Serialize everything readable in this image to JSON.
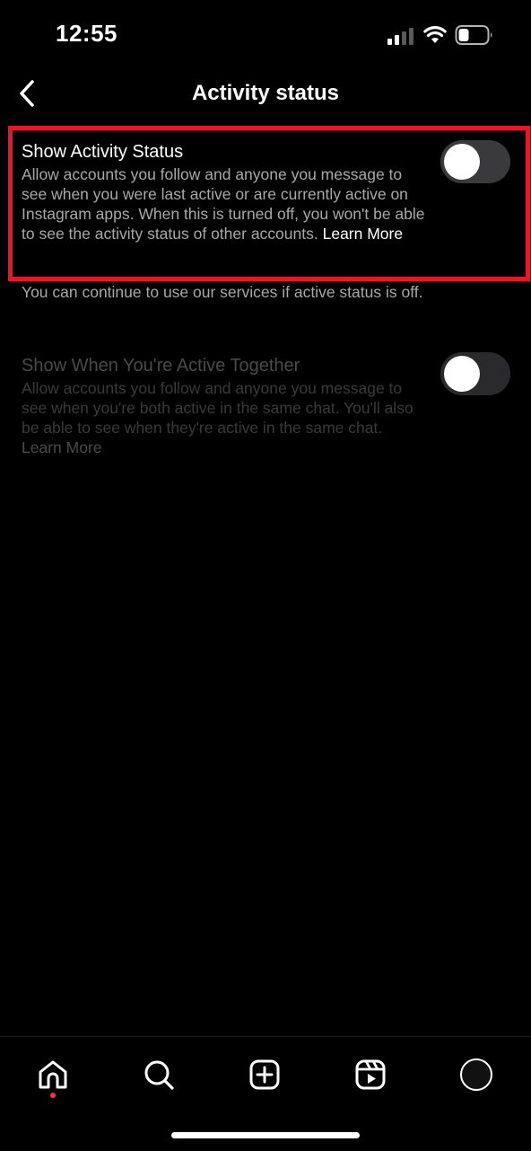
{
  "status_bar": {
    "time": "12:55"
  },
  "header": {
    "title": "Activity status",
    "back_icon": "chevron-left-icon"
  },
  "settings": [
    {
      "title": "Show Activity Status",
      "description": "Allow accounts you follow and anyone you message to see when you were last active or are currently active on Instagram apps. When this is turned off, you won't be able to see the activity status of other accounts.",
      "learn_more": "Learn More",
      "enabled": false,
      "disabled_row": false
    },
    {
      "title": "Show When You're Active Together",
      "description": "Allow accounts you follow and anyone you message to see when you're both active in the same chat. You'll also be able to see when they're active in the same chat.",
      "learn_more": "Learn More",
      "enabled": false,
      "disabled_row": true
    }
  ],
  "info_note": "You can continue to use our services if active status is off.",
  "bottom_nav": {
    "items": [
      "home-icon",
      "search-icon",
      "create-icon",
      "reels-icon",
      "profile-avatar"
    ],
    "active": "home-icon"
  },
  "colors": {
    "background": "#000000",
    "highlight": "#e8162b",
    "notification_dot": "#ff3040",
    "secondary_text": "#a8a8a8"
  }
}
